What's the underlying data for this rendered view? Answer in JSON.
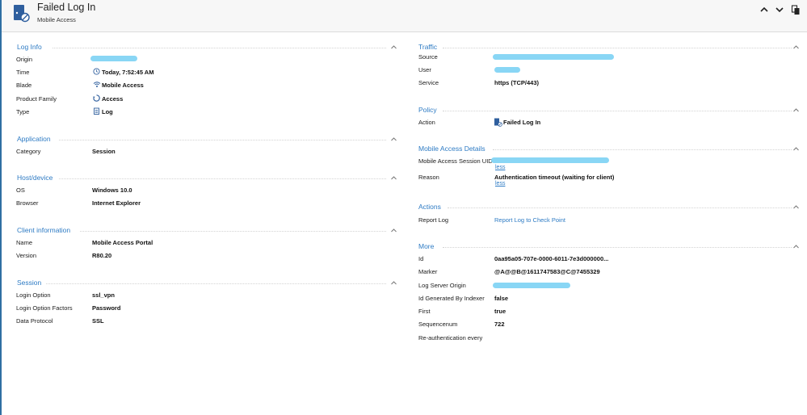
{
  "header": {
    "title": "Failed Log In",
    "subtitle": "Mobile Access",
    "icons": [
      "failed-login-icon",
      "collapse-up-icon",
      "expand-down-icon",
      "copy-icon"
    ]
  },
  "left": {
    "log_info": {
      "title": "Log Info",
      "rows": [
        {
          "label": "Origin",
          "value": ""
        },
        {
          "label": "Time",
          "value": "Today, 7:52:45 AM",
          "icon": "clock-icon"
        },
        {
          "label": "Blade",
          "value": "Mobile Access",
          "icon": "wifi-icon"
        },
        {
          "label": "Product Family",
          "value": "Access",
          "icon": "access-icon"
        },
        {
          "label": "Type",
          "value": "Log",
          "icon": "log-icon"
        }
      ]
    },
    "application": {
      "title": "Application",
      "rows": [
        {
          "label": "Category",
          "value": "Session"
        }
      ]
    },
    "host": {
      "title": "Host/device",
      "rows": [
        {
          "label": "OS",
          "value": "Windows 10.0"
        },
        {
          "label": "Browser",
          "value": "Internet Explorer"
        }
      ]
    },
    "client": {
      "title": "Client information",
      "rows": [
        {
          "label": "Name",
          "value": "Mobile Access Portal"
        },
        {
          "label": "Version",
          "value": "R80.20"
        }
      ]
    },
    "session": {
      "title": "Session",
      "rows": [
        {
          "label": "Login Option",
          "value": "ssl_vpn"
        },
        {
          "label": "Login Option Factors",
          "value": "Password"
        },
        {
          "label": "Data Protocol",
          "value": "SSL"
        }
      ]
    }
  },
  "right": {
    "traffic": {
      "title": "Traffic",
      "rows": [
        {
          "label": "Source",
          "value": ""
        },
        {
          "label": "User",
          "value": ""
        },
        {
          "label": "Service",
          "value": "https (TCP/443)"
        }
      ]
    },
    "policy": {
      "title": "Policy",
      "rows": [
        {
          "label": "Action",
          "value": "Failed Log In",
          "icon": "failed-login-icon"
        }
      ]
    },
    "mobile": {
      "title": "Mobile Access Details",
      "rows": [
        {
          "label": "Mobile Access Session UID",
          "value": "",
          "more": "less"
        },
        {
          "label": "Reason",
          "value": "Authentication timeout (waiting for client)",
          "more": "less"
        }
      ]
    },
    "actions": {
      "title": "Actions",
      "rows": [
        {
          "label": "Report Log",
          "value": "Report Log to Check Point"
        }
      ]
    },
    "more": {
      "title": "More",
      "rows": [
        {
          "label": "Id",
          "value": "0aa95a05-707e-0000-6011-7e3d000000..."
        },
        {
          "label": "Marker",
          "value": "@A@@B@1611747583@C@7455329"
        },
        {
          "label": "Log Server Origin",
          "value": ""
        },
        {
          "label": "Id Generated By Indexer",
          "value": "false"
        },
        {
          "label": "First",
          "value": "true"
        },
        {
          "label": "Sequencenum",
          "value": "722"
        },
        {
          "label": "Re-authentication every",
          "value": ""
        }
      ]
    }
  },
  "colors": {
    "accent": "#2e7bc4",
    "redaction": "#7fd3f4",
    "icon_blue": "#2f5f9e"
  }
}
